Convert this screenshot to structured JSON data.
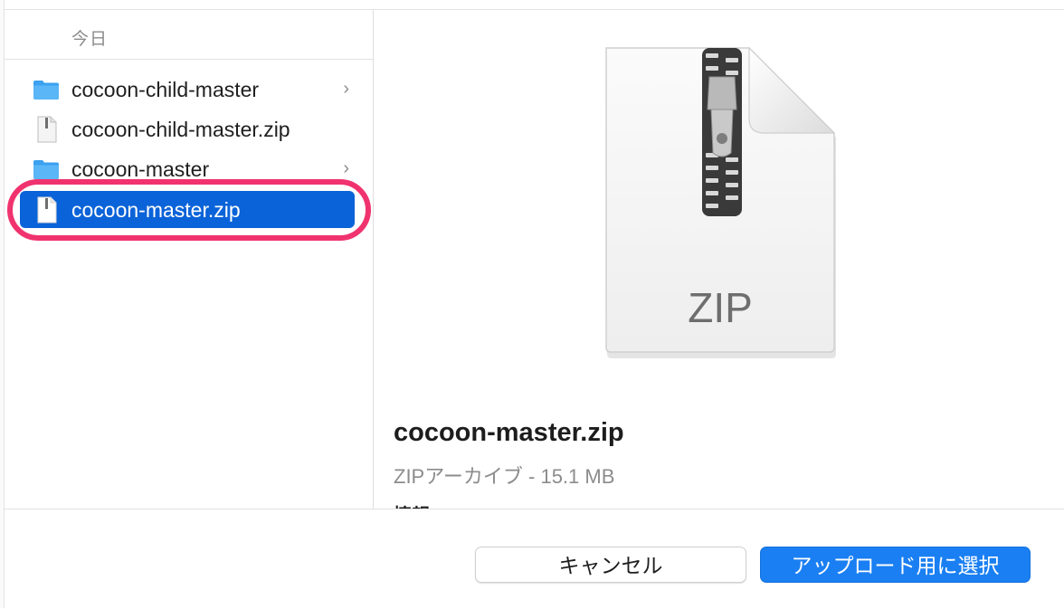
{
  "list": {
    "section_header": "今日",
    "items": [
      {
        "label": "cocoon-child-master",
        "kind": "folder",
        "has_chevron": true,
        "selected": false
      },
      {
        "label": "cocoon-child-master.zip",
        "kind": "zip",
        "has_chevron": false,
        "selected": false
      },
      {
        "label": "cocoon-master",
        "kind": "folder",
        "has_chevron": true,
        "selected": false
      },
      {
        "label": "cocoon-master.zip",
        "kind": "zip",
        "has_chevron": false,
        "selected": true
      }
    ],
    "chevron_glyph": "›"
  },
  "preview": {
    "icon_text": "ZIP",
    "file_name": "cocoon-master.zip",
    "file_kind": "ZIPアーカイブ - 15.1 MB",
    "info_label": "情報"
  },
  "buttons": {
    "cancel_label": "キャンセル",
    "primary_label": "アップロード用に選択"
  },
  "colors": {
    "selection": "#0a63d8",
    "highlight_ring": "#f0336f",
    "primary_button": "#1a7ff2",
    "folder_icon": "#3ba1f0"
  }
}
